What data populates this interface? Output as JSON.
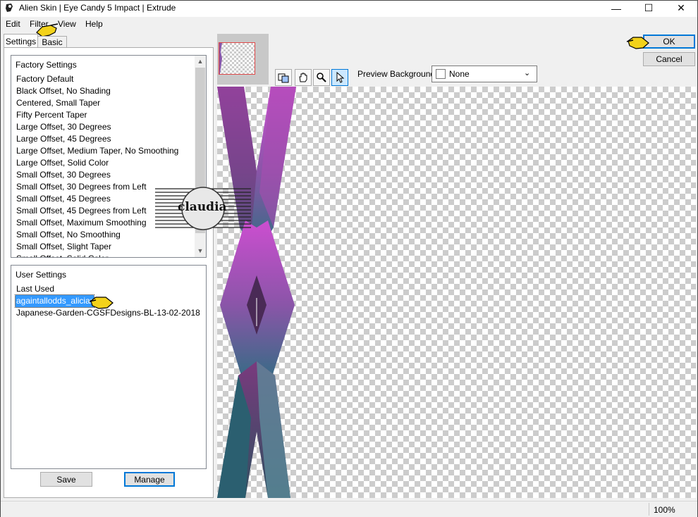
{
  "window": {
    "title": "Alien Skin | Eye Candy 5 Impact | Extrude",
    "minimize_glyph": "—",
    "maximize_glyph": "☐",
    "close_glyph": "✕"
  },
  "menu": [
    "Edit",
    "Filter",
    "View",
    "Help"
  ],
  "tabs": {
    "settings": "Settings",
    "basic": "Basic"
  },
  "factory_settings": {
    "heading": "Factory Settings",
    "items": [
      "Factory Default",
      "Black Offset, No Shading",
      "Centered, Small Taper",
      "Fifty Percent Taper",
      "Large Offset, 30 Degrees",
      "Large Offset, 45 Degrees",
      "Large Offset, Medium Taper, No Smoothing",
      "Large Offset, Solid Color",
      "Small Offset, 30 Degrees",
      "Small Offset, 30 Degrees from Left",
      "Small Offset, 45 Degrees",
      "Small Offset, 45 Degrees from Left",
      "Small Offset, Maximum Smoothing",
      "Small Offset, No Smoothing",
      "Small Offset, Slight Taper",
      "Small Offset, Solid Color"
    ]
  },
  "user_settings": {
    "heading": "User Settings",
    "items": [
      "Last Used",
      "againtallodds_aliciar",
      "Japanese-Garden-CGSFDesigns-BL-13-02-2018"
    ],
    "selected_index": 1
  },
  "buttons": {
    "save": "Save",
    "manage": "Manage",
    "ok": "OK",
    "cancel": "Cancel"
  },
  "preview_background": {
    "label": "Preview Background:",
    "value": "None"
  },
  "watermark": {
    "text": "claudia"
  },
  "status": {
    "zoom": "100%"
  },
  "colors": {
    "selection": "#3399ff",
    "shape_top": "#cc4ed0",
    "shape_mid": "#8a55a8",
    "shape_bottom": "#2a6f80",
    "pointer": "#f3d21b"
  }
}
